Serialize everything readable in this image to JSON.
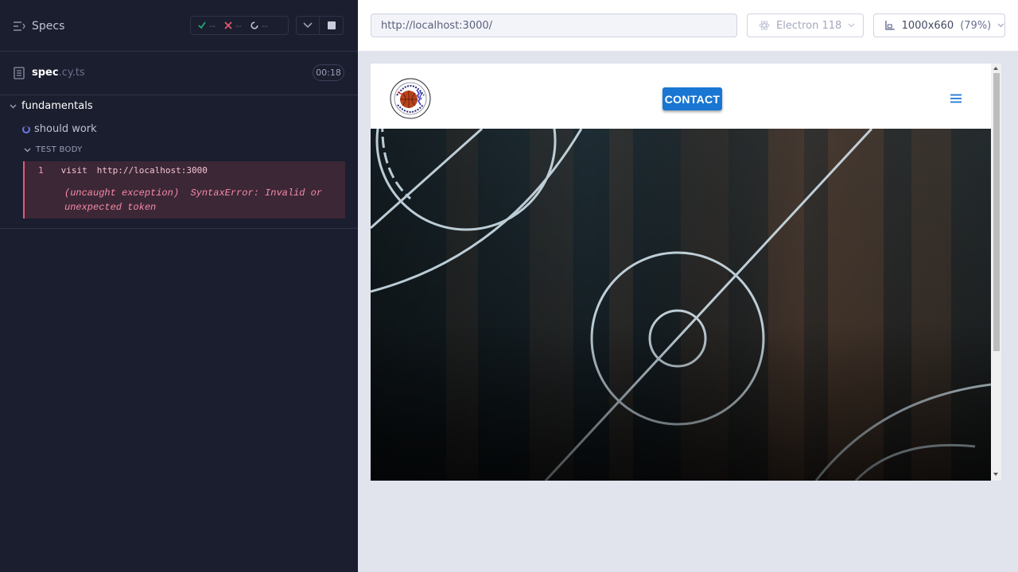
{
  "reporter": {
    "specs_label": "Specs",
    "stats": {
      "passed": "--",
      "failed": "--",
      "pending": "--"
    },
    "spec": {
      "name": "spec",
      "ext": ".cy.ts",
      "duration": "00:18"
    },
    "suite": {
      "title": "fundamentals"
    },
    "test": {
      "title": "should work",
      "body_label": "TEST BODY"
    },
    "command": {
      "number": "1",
      "name": "visit",
      "arg": "http://localhost:3000"
    },
    "error": {
      "prefix": "(uncaught exception)",
      "message": "SyntaxError: Invalid or unexpected token"
    }
  },
  "aut": {
    "url": "http://localhost:3000/",
    "browser": "Electron 118",
    "viewport": {
      "size": "1000x660",
      "scale": "(79%)"
    },
    "site": {
      "contact_label": "CONTACT"
    }
  },
  "colors": {
    "panel_bg": "#1b1e2e",
    "error_bg": "#3c2737",
    "error_text": "#f58ca4",
    "contact_blue": "#1976d2",
    "passed": "#1fa971",
    "failed": "#e45770"
  },
  "icons": [
    "specs-list-icon",
    "check-icon",
    "x-icon",
    "spinner-icon",
    "chevron-down-icon",
    "stop-icon",
    "file-icon",
    "electron-icon",
    "viewport-icon",
    "hamburger-icon"
  ]
}
